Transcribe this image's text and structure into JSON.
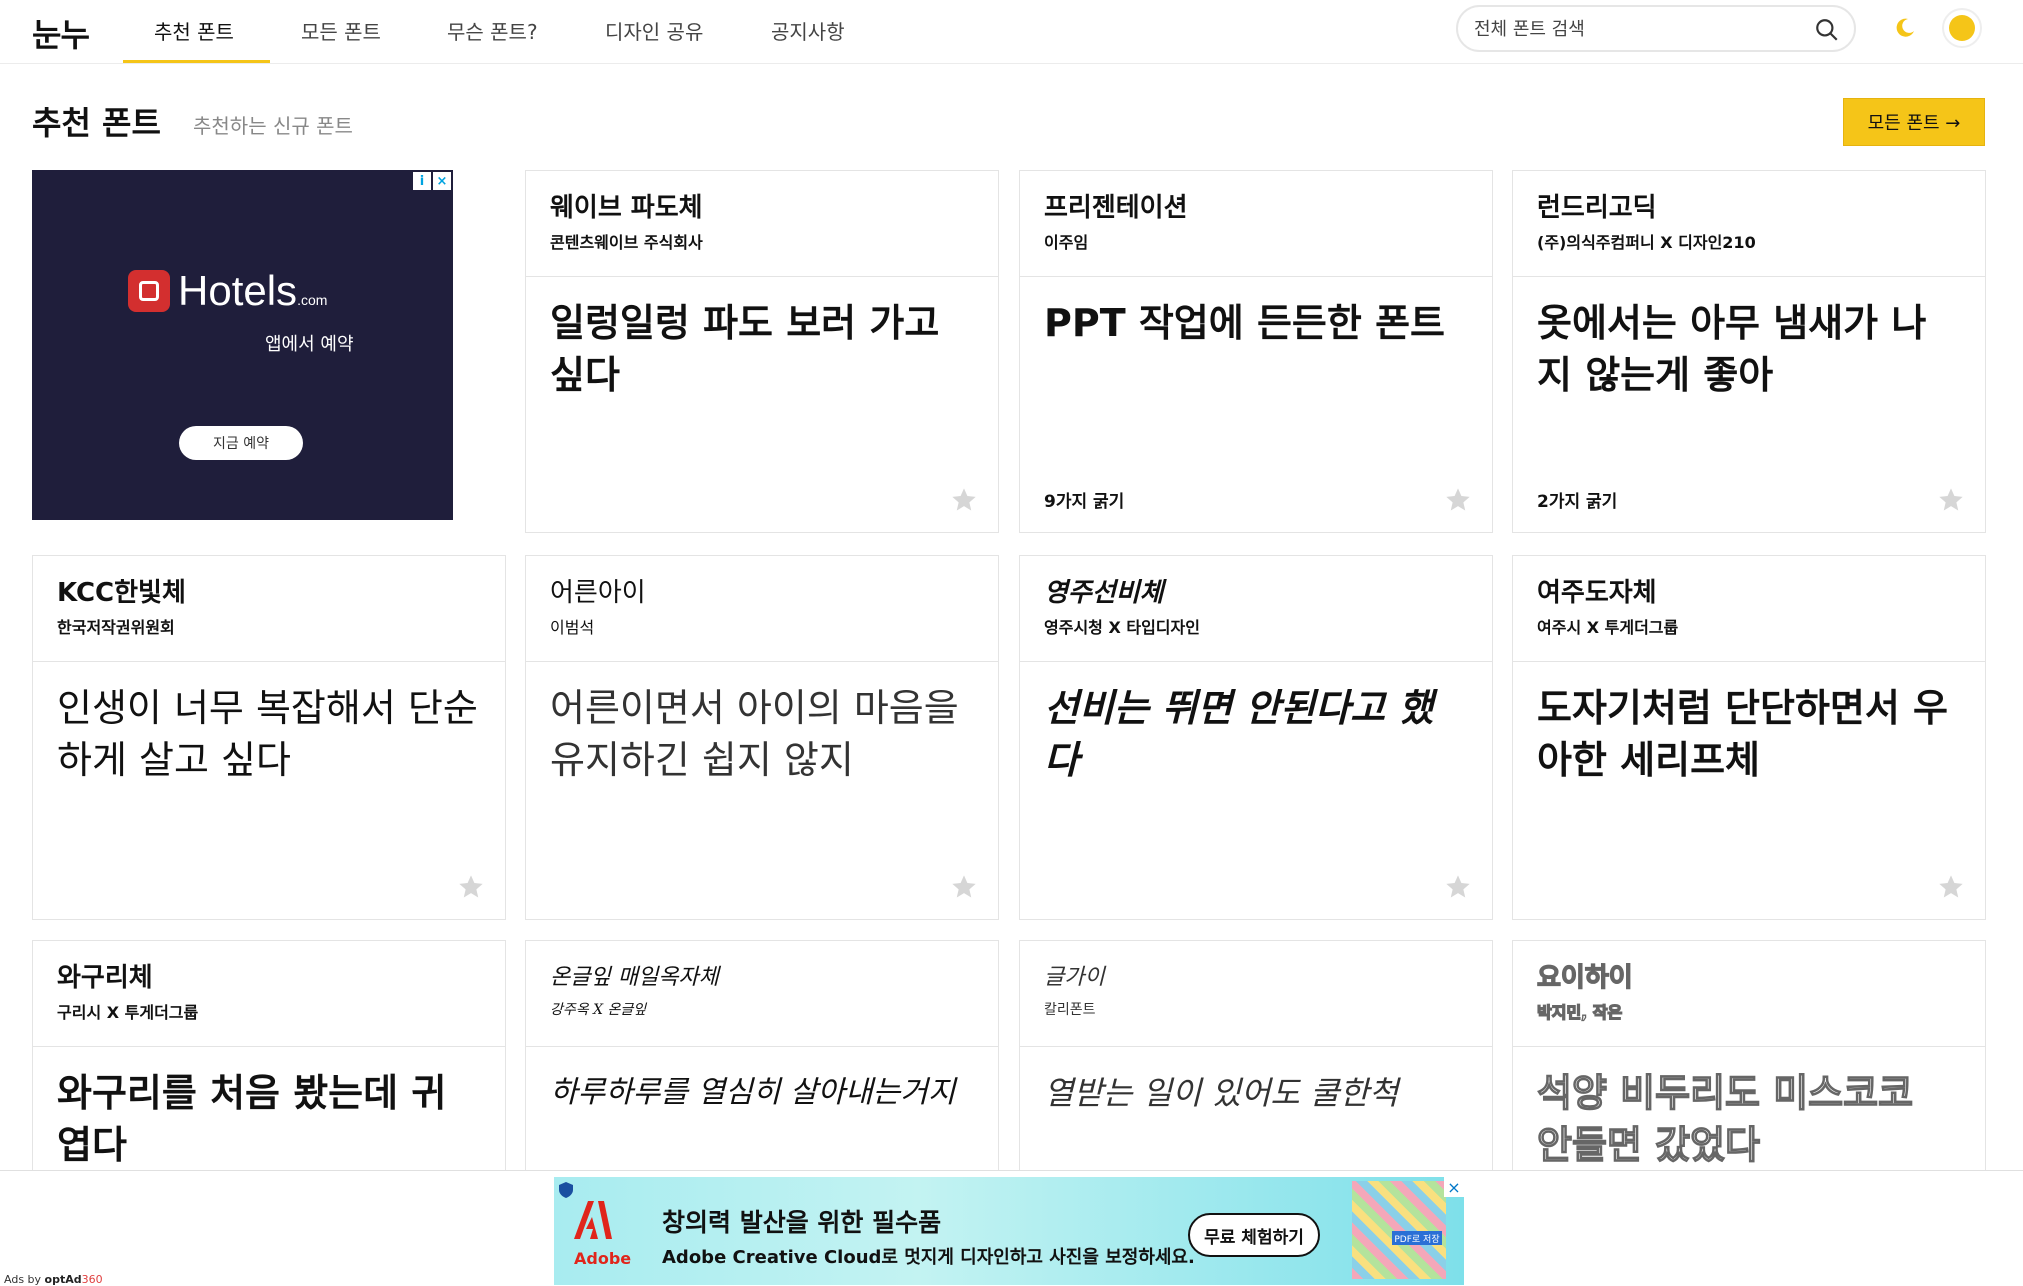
{
  "nav": {
    "logo": "눈누",
    "tabs": [
      "추천 폰트",
      "모든 폰트",
      "무슨 폰트?",
      "디자인 공유",
      "공지사항"
    ],
    "search_placeholder": "전체 폰트 검색",
    "accent_color": "#f5c518"
  },
  "header": {
    "title": "추천 폰트",
    "subtitle": "추천하는 신규 폰트",
    "all_fonts_button": "모든 폰트 →"
  },
  "side_ad": {
    "brand": "Hotels",
    "brand_suffix": ".com",
    "tagline": "앱에서 예약",
    "button": "지금 예약"
  },
  "cards": [
    {
      "name": "웨이브 파도체",
      "maker": "콘텐츠웨이브 주식회사",
      "sample": "일렁일렁 파도 보러 가고 싶다",
      "weights": ""
    },
    {
      "name": "프리젠테이션",
      "maker": "이주임",
      "sample": "PPT 작업에 든든한 폰트",
      "weights": "9가지 굵기"
    },
    {
      "name": "런드리고딕",
      "maker": "(주)의식주컴퍼니 X 디자인210",
      "sample": "옷에서는 아무 냄새가 나지 않는게 좋아",
      "weights": "2가지 굵기"
    },
    {
      "name": "KCC한빛체",
      "maker": "한국저작권위원회",
      "sample": "인생이 너무 복잡해서 단순하게 살고 싶다",
      "weights": ""
    },
    {
      "name": "어른아이",
      "maker": "이범석",
      "sample": "어른이면서 아이의 마음을 유지하긴 쉽지 않지",
      "weights": ""
    },
    {
      "name": "영주선비체",
      "maker": "영주시청 X 타입디자인",
      "sample": "선비는 뛰면 안된다고 했다",
      "weights": ""
    },
    {
      "name": "여주도자체",
      "maker": "여주시 X 투게더그룹",
      "sample": "도자기처럼 단단하면서 우아한 세리프체",
      "weights": ""
    },
    {
      "name": "와구리체",
      "maker": "구리시 X 투게더그룹",
      "sample": "와구리를 처음 봤는데 귀엽다",
      "weights": ""
    },
    {
      "name": "온글잎 매일옥자체",
      "maker": "강주옥 X 온글잎",
      "sample": "하루하루를 열심히 살아내는거지",
      "weights": ""
    },
    {
      "name": "글가이",
      "maker": "칼리폰트",
      "sample": "열받는 일이 있어도 쿨한척",
      "weights": ""
    },
    {
      "name": "요이하이",
      "maker": "박지민, 작은",
      "sample": "석양 비두리도 미스코코 안들면 갔었다",
      "weights": ""
    }
  ],
  "bottom_ad": {
    "brand": "Adobe",
    "headline": "창의력 발산을 위한 필수품",
    "description": "Adobe Creative Cloud로 멋지게 디자인하고 사진을 보정하세요.",
    "cta": "무료 체험하기",
    "thumb_badge": "PDF로 저장",
    "ads_by_prefix": "Ads by ",
    "ads_by_brand": "optAd",
    "ads_by_suffix": "360"
  }
}
